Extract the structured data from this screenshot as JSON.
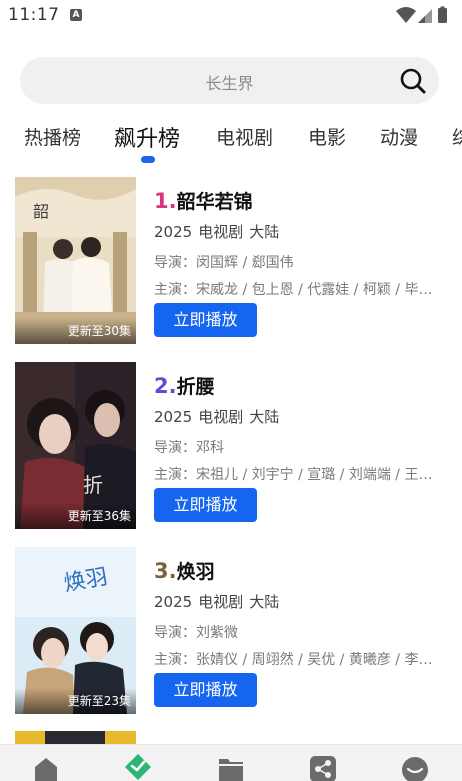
{
  "status_bar": {
    "time": "11:17",
    "notification_glyph": "A",
    "icons": [
      "wifi-icon",
      "signal-icon",
      "battery-icon"
    ]
  },
  "search": {
    "placeholder": "长生界"
  },
  "tabs": [
    {
      "label": "热播榜",
      "active": false
    },
    {
      "label": "飙升榜",
      "active": true
    },
    {
      "label": "电视剧",
      "active": false
    },
    {
      "label": "电影",
      "active": false
    },
    {
      "label": "动漫",
      "active": false
    },
    {
      "label": "综",
      "active": false
    }
  ],
  "items": [
    {
      "rank": "1.",
      "rank_color": "#d6357f",
      "title": "韶华若锦",
      "year": "2025",
      "category": "电视剧",
      "region": "大陆",
      "director": "导演：闵国辉 / 郄国伟",
      "cast": "主演：宋威龙 / 包上恩 / 代露娃 / 柯颖 / 毕雯珺",
      "update": "更新至30集",
      "play_label": "立即播放"
    },
    {
      "rank": "2.",
      "rank_color": "#5a4fcf",
      "title": "折腰",
      "year": "2025",
      "category": "电视剧",
      "region": "大陆",
      "director": "导演：邓科",
      "cast": "主演：宋祖儿 / 刘宇宁 / 宣璐 / 刘端端 / 王鹤润",
      "update": "更新至36集",
      "play_label": "立即播放"
    },
    {
      "rank": "3.",
      "rank_color": "#7a6240",
      "title": "焕羽",
      "year": "2025",
      "category": "电视剧",
      "region": "大陆",
      "director": "导演：刘紫微",
      "cast": "主演：张婧仪 / 周翊然 / 吴优 / 黄曦彦 / 李泽锋",
      "update": "更新至23集",
      "play_label": "立即播放"
    }
  ],
  "bottom_nav": [
    {
      "icon": "home-icon"
    },
    {
      "icon": "discover-icon",
      "active": true
    },
    {
      "icon": "folder-icon"
    },
    {
      "icon": "share-icon"
    },
    {
      "icon": "profile-icon"
    }
  ],
  "colors": {
    "accent": "#1565f0",
    "nav_active": "#2bb673"
  }
}
